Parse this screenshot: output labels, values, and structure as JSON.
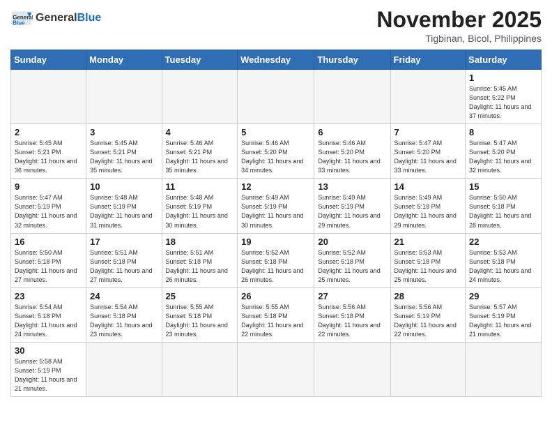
{
  "header": {
    "logo_general": "General",
    "logo_blue": "Blue",
    "month_title": "November 2025",
    "location": "Tigbinan, Bicol, Philippines"
  },
  "days_of_week": [
    "Sunday",
    "Monday",
    "Tuesday",
    "Wednesday",
    "Thursday",
    "Friday",
    "Saturday"
  ],
  "weeks": [
    [
      {
        "day": "",
        "empty": true
      },
      {
        "day": "",
        "empty": true
      },
      {
        "day": "",
        "empty": true
      },
      {
        "day": "",
        "empty": true
      },
      {
        "day": "",
        "empty": true
      },
      {
        "day": "",
        "empty": true
      },
      {
        "day": "1",
        "sunrise": "Sunrise: 5:45 AM",
        "sunset": "Sunset: 5:22 PM",
        "daylight": "Daylight: 11 hours and 37 minutes."
      }
    ],
    [
      {
        "day": "2",
        "sunrise": "Sunrise: 5:45 AM",
        "sunset": "Sunset: 5:21 PM",
        "daylight": "Daylight: 11 hours and 36 minutes."
      },
      {
        "day": "3",
        "sunrise": "Sunrise: 5:45 AM",
        "sunset": "Sunset: 5:21 PM",
        "daylight": "Daylight: 11 hours and 35 minutes."
      },
      {
        "day": "4",
        "sunrise": "Sunrise: 5:46 AM",
        "sunset": "Sunset: 5:21 PM",
        "daylight": "Daylight: 11 hours and 35 minutes."
      },
      {
        "day": "5",
        "sunrise": "Sunrise: 5:46 AM",
        "sunset": "Sunset: 5:20 PM",
        "daylight": "Daylight: 11 hours and 34 minutes."
      },
      {
        "day": "6",
        "sunrise": "Sunrise: 5:46 AM",
        "sunset": "Sunset: 5:20 PM",
        "daylight": "Daylight: 11 hours and 33 minutes."
      },
      {
        "day": "7",
        "sunrise": "Sunrise: 5:47 AM",
        "sunset": "Sunset: 5:20 PM",
        "daylight": "Daylight: 11 hours and 33 minutes."
      },
      {
        "day": "8",
        "sunrise": "Sunrise: 5:47 AM",
        "sunset": "Sunset: 5:20 PM",
        "daylight": "Daylight: 11 hours and 32 minutes."
      }
    ],
    [
      {
        "day": "9",
        "sunrise": "Sunrise: 5:47 AM",
        "sunset": "Sunset: 5:19 PM",
        "daylight": "Daylight: 11 hours and 32 minutes."
      },
      {
        "day": "10",
        "sunrise": "Sunrise: 5:48 AM",
        "sunset": "Sunset: 5:19 PM",
        "daylight": "Daylight: 11 hours and 31 minutes."
      },
      {
        "day": "11",
        "sunrise": "Sunrise: 5:48 AM",
        "sunset": "Sunset: 5:19 PM",
        "daylight": "Daylight: 11 hours and 30 minutes."
      },
      {
        "day": "12",
        "sunrise": "Sunrise: 5:49 AM",
        "sunset": "Sunset: 5:19 PM",
        "daylight": "Daylight: 11 hours and 30 minutes."
      },
      {
        "day": "13",
        "sunrise": "Sunrise: 5:49 AM",
        "sunset": "Sunset: 5:19 PM",
        "daylight": "Daylight: 11 hours and 29 minutes."
      },
      {
        "day": "14",
        "sunrise": "Sunrise: 5:49 AM",
        "sunset": "Sunset: 5:18 PM",
        "daylight": "Daylight: 11 hours and 29 minutes."
      },
      {
        "day": "15",
        "sunrise": "Sunrise: 5:50 AM",
        "sunset": "Sunset: 5:18 PM",
        "daylight": "Daylight: 11 hours and 28 minutes."
      }
    ],
    [
      {
        "day": "16",
        "sunrise": "Sunrise: 5:50 AM",
        "sunset": "Sunset: 5:18 PM",
        "daylight": "Daylight: 11 hours and 27 minutes."
      },
      {
        "day": "17",
        "sunrise": "Sunrise: 5:51 AM",
        "sunset": "Sunset: 5:18 PM",
        "daylight": "Daylight: 11 hours and 27 minutes."
      },
      {
        "day": "18",
        "sunrise": "Sunrise: 5:51 AM",
        "sunset": "Sunset: 5:18 PM",
        "daylight": "Daylight: 11 hours and 26 minutes."
      },
      {
        "day": "19",
        "sunrise": "Sunrise: 5:52 AM",
        "sunset": "Sunset: 5:18 PM",
        "daylight": "Daylight: 11 hours and 26 minutes."
      },
      {
        "day": "20",
        "sunrise": "Sunrise: 5:52 AM",
        "sunset": "Sunset: 5:18 PM",
        "daylight": "Daylight: 11 hours and 25 minutes."
      },
      {
        "day": "21",
        "sunrise": "Sunrise: 5:53 AM",
        "sunset": "Sunset: 5:18 PM",
        "daylight": "Daylight: 11 hours and 25 minutes."
      },
      {
        "day": "22",
        "sunrise": "Sunrise: 5:53 AM",
        "sunset": "Sunset: 5:18 PM",
        "daylight": "Daylight: 11 hours and 24 minutes."
      }
    ],
    [
      {
        "day": "23",
        "sunrise": "Sunrise: 5:54 AM",
        "sunset": "Sunset: 5:18 PM",
        "daylight": "Daylight: 11 hours and 24 minutes."
      },
      {
        "day": "24",
        "sunrise": "Sunrise: 5:54 AM",
        "sunset": "Sunset: 5:18 PM",
        "daylight": "Daylight: 11 hours and 23 minutes."
      },
      {
        "day": "25",
        "sunrise": "Sunrise: 5:55 AM",
        "sunset": "Sunset: 5:18 PM",
        "daylight": "Daylight: 11 hours and 23 minutes."
      },
      {
        "day": "26",
        "sunrise": "Sunrise: 5:55 AM",
        "sunset": "Sunset: 5:18 PM",
        "daylight": "Daylight: 11 hours and 22 minutes."
      },
      {
        "day": "27",
        "sunrise": "Sunrise: 5:56 AM",
        "sunset": "Sunset: 5:18 PM",
        "daylight": "Daylight: 11 hours and 22 minutes."
      },
      {
        "day": "28",
        "sunrise": "Sunrise: 5:56 AM",
        "sunset": "Sunset: 5:19 PM",
        "daylight": "Daylight: 11 hours and 22 minutes."
      },
      {
        "day": "29",
        "sunrise": "Sunrise: 5:57 AM",
        "sunset": "Sunset: 5:19 PM",
        "daylight": "Daylight: 11 hours and 21 minutes."
      }
    ],
    [
      {
        "day": "30",
        "sunrise": "Sunrise: 5:58 AM",
        "sunset": "Sunset: 5:19 PM",
        "daylight": "Daylight: 11 hours and 21 minutes."
      },
      {
        "day": "",
        "empty": true
      },
      {
        "day": "",
        "empty": true
      },
      {
        "day": "",
        "empty": true
      },
      {
        "day": "",
        "empty": true
      },
      {
        "day": "",
        "empty": true
      },
      {
        "day": "",
        "empty": true
      }
    ]
  ]
}
